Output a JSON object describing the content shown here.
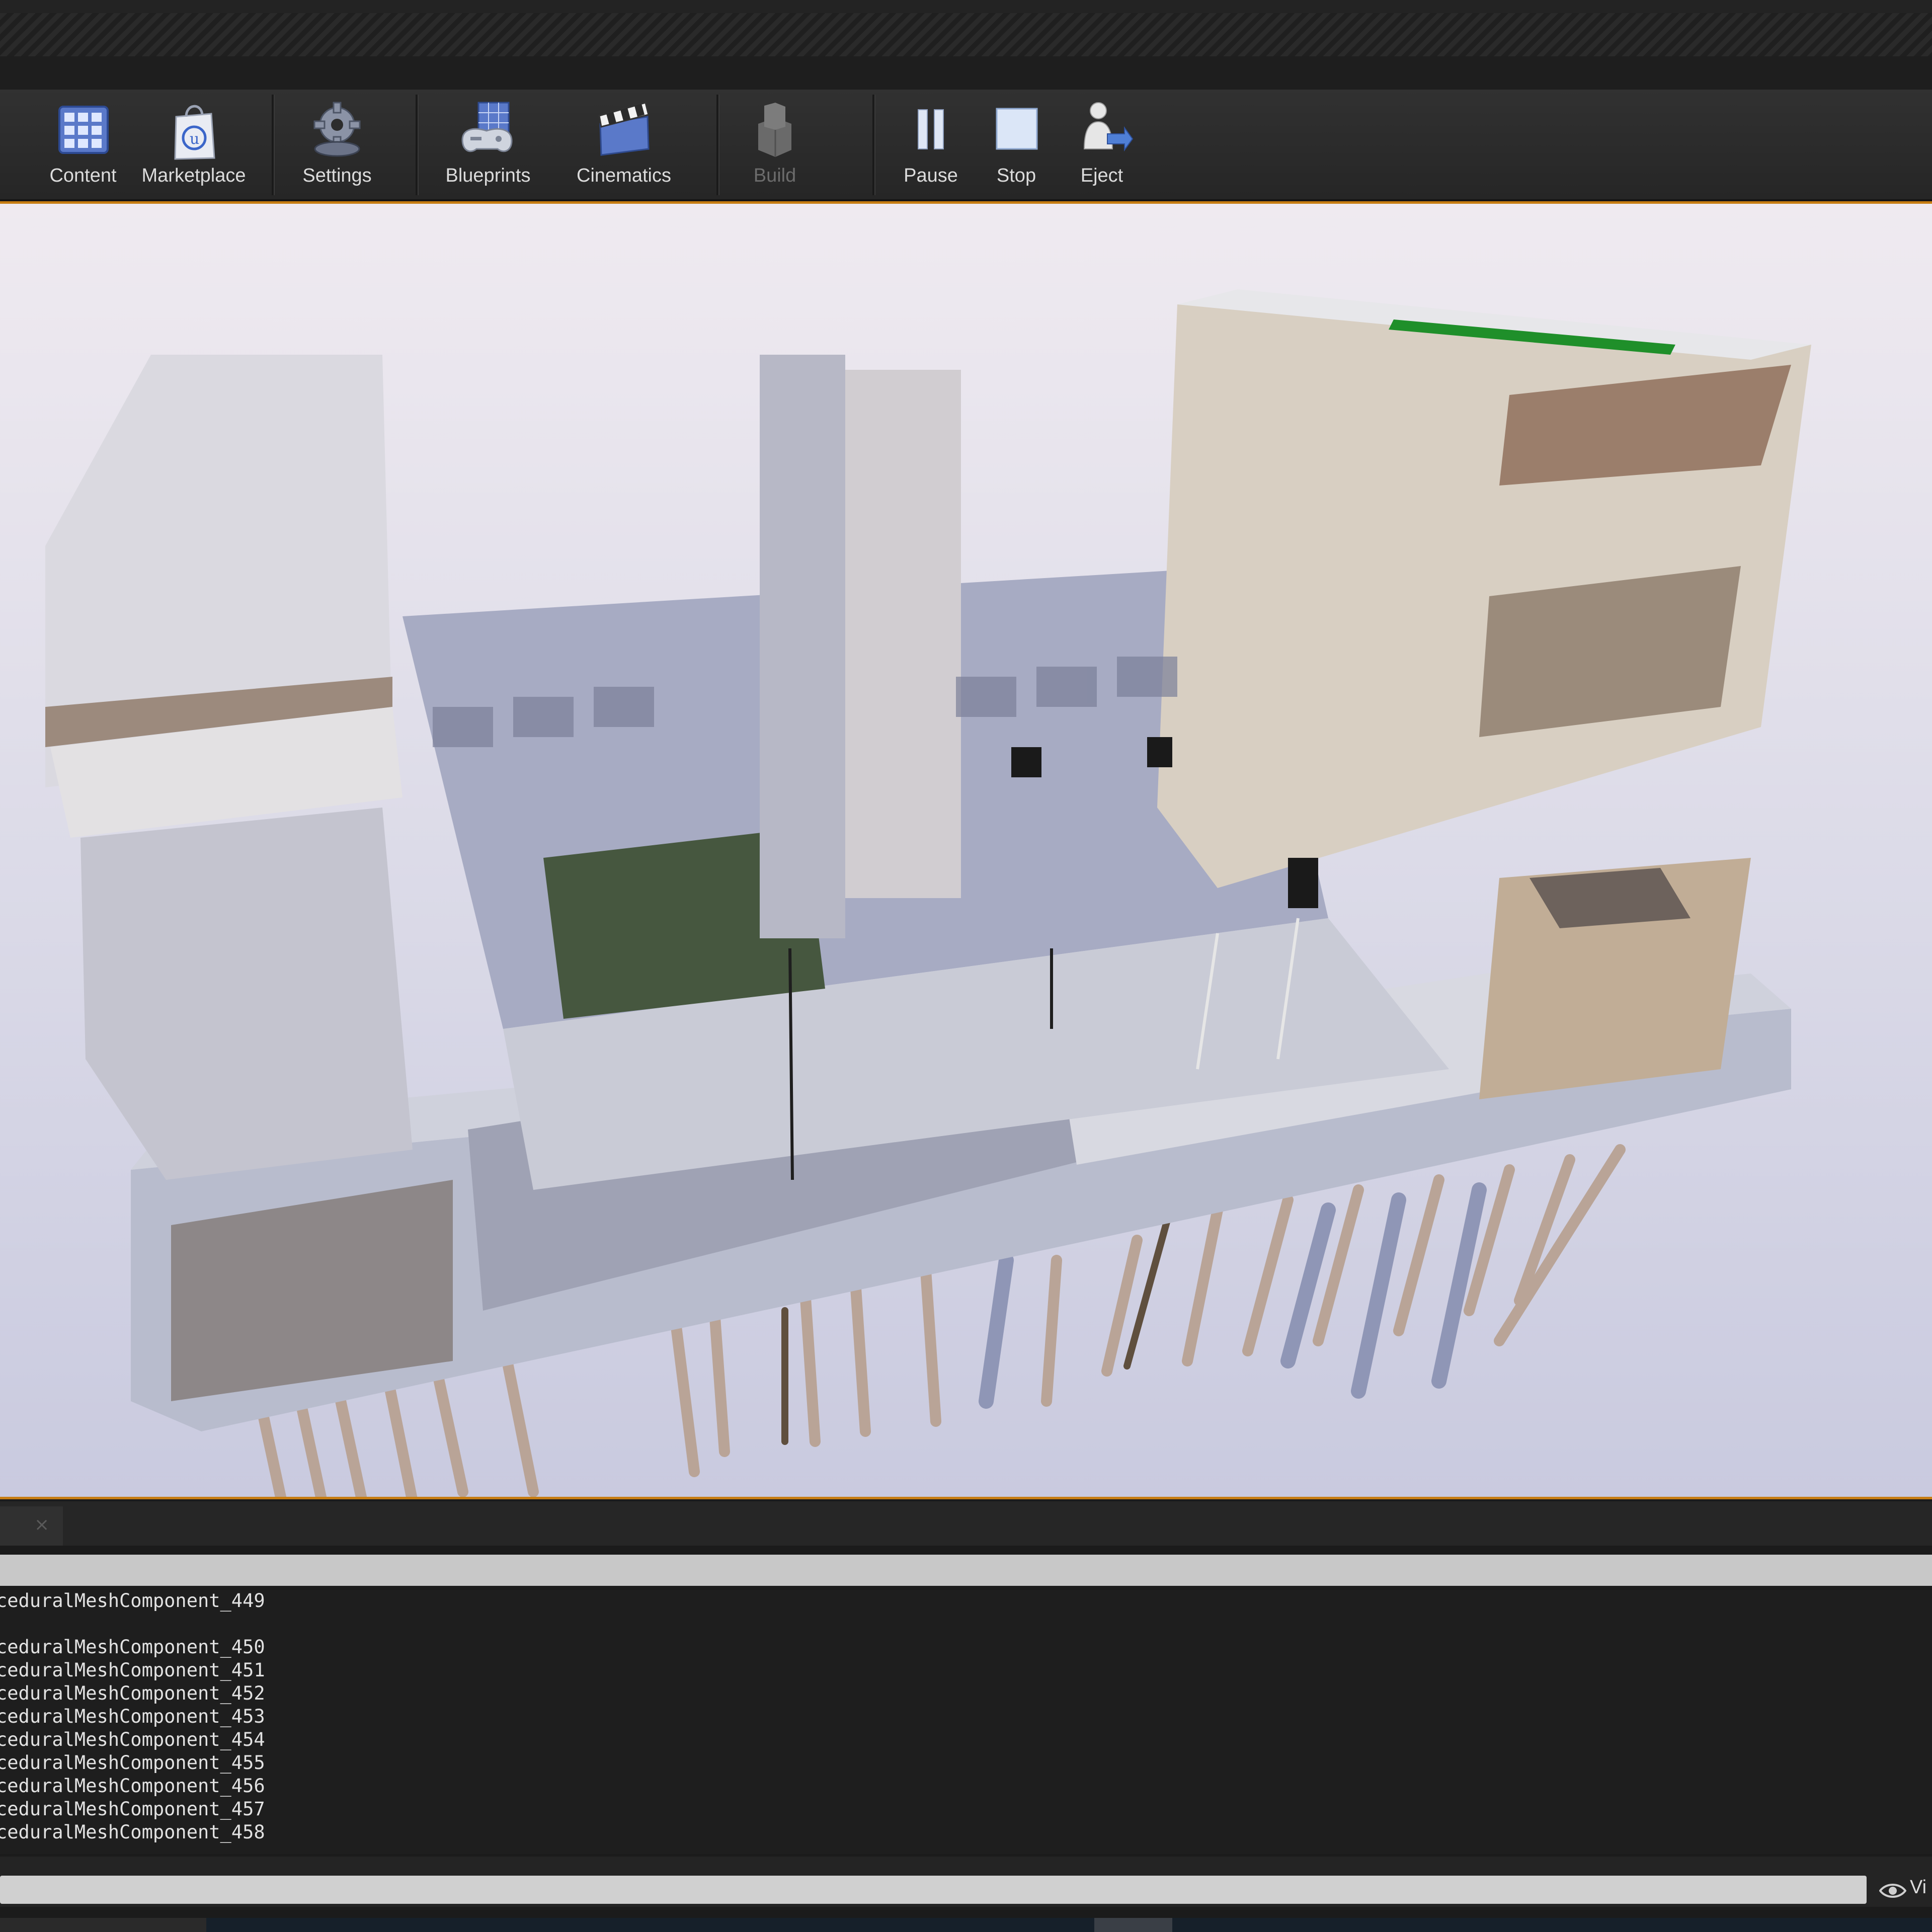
{
  "toolbar": {
    "items": [
      {
        "label": "Content",
        "icon": "content-browser-icon"
      },
      {
        "label": "Marketplace",
        "icon": "marketplace-bag-icon"
      },
      {
        "label": "Settings",
        "icon": "gear-icon"
      },
      {
        "label": "Blueprints",
        "icon": "gamepad-icon"
      },
      {
        "label": "Cinematics",
        "icon": "clapperboard-icon"
      },
      {
        "label": "Build",
        "icon": "build-blocks-icon"
      },
      {
        "label": "Pause",
        "icon": "pause-icon"
      },
      {
        "label": "Stop",
        "icon": "stop-icon"
      },
      {
        "label": "Eject",
        "icon": "eject-icon"
      }
    ]
  },
  "output_log": {
    "lines": [
      "ceduralMeshComponent_449",
      "",
      "ceduralMeshComponent_450",
      "ceduralMeshComponent_451",
      "ceduralMeshComponent_452",
      "ceduralMeshComponent_453",
      "ceduralMeshComponent_454",
      "ceduralMeshComponent_455",
      "ceduralMeshComponent_456",
      "ceduralMeshComponent_457",
      "ceduralMeshComponent_458"
    ]
  },
  "console": {
    "input_value": "",
    "view_options_label": "Vi"
  },
  "colors": {
    "accent": "#c77d12",
    "toolbar_bg": "#2c2c2c",
    "log_bg": "#1e1e1e"
  }
}
